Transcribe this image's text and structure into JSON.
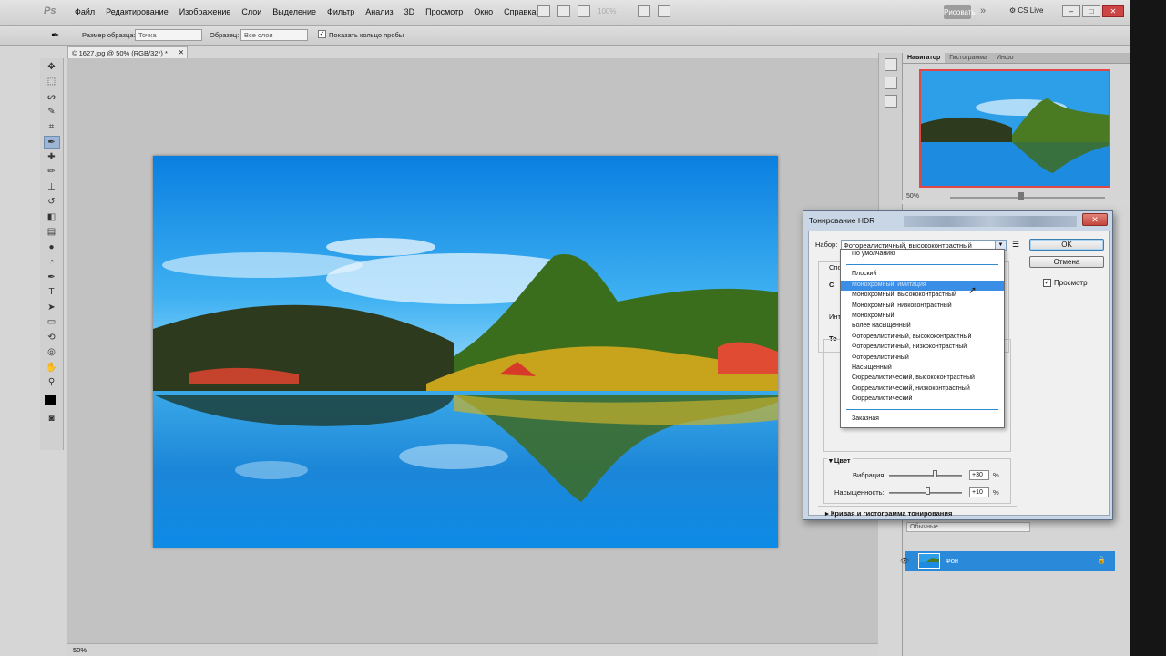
{
  "menubar": {
    "logo": "Ps",
    "items": [
      "Файл",
      "Редактирование",
      "Изображение",
      "Слои",
      "Выделение",
      "Фильтр",
      "Анализ",
      "3D",
      "Просмотр",
      "Окно",
      "Справка"
    ],
    "zoom": "100%",
    "workspace": "Рисовать",
    "cs_live": "CS Live"
  },
  "options": {
    "sample_size_label": "Размер образца:",
    "sample_size_value": "Точка",
    "sample_label": "Образец:",
    "sample_value": "Все слои",
    "show_ring_label": "Показать кольцо пробы"
  },
  "document": {
    "tab_title": "© 1627.jpg @ 50% (RGB/32*) *",
    "zoom": "50%"
  },
  "navigator": {
    "tabs": [
      "Навигатор",
      "Гистограмма",
      "Инфо"
    ],
    "zoom": "50%"
  },
  "layers": {
    "blend_mode": "Обычные",
    "layer_name": "Фон"
  },
  "dialog": {
    "title": "Тонирование HDR",
    "preset_label": "Набор:",
    "preset_value": "Фотореалистичный, высококонтрастный",
    "ok_label": "OK",
    "cancel_label": "Отмена",
    "preview_label": "Просмотр",
    "partial_labels": [
      "Спо",
      "С",
      "Инт",
      "То"
    ],
    "color_section": "Цвет",
    "vibrance_label": "Вибрация:",
    "vibrance_value": "+30",
    "saturation_label": "Насыщенность:",
    "saturation_value": "+10",
    "percent": "%",
    "curve_section": "Кривая и гистограмма тонирования"
  },
  "dropdown": {
    "items_top": [
      "По умолчанию"
    ],
    "items_mid": [
      "Плоский",
      "Монохромный, имитация",
      "Монохромный, высококонтрастный",
      "Монохромный, низкоконтрастный",
      "Монохромный",
      "Более насыщенный",
      "Фотореалистичный, высококонтрастный",
      "Фотореалистичный, низкоконтрастный",
      "Фотореалистичный",
      "Насыщенный",
      "Сюрреалистический, высококонтрастный",
      "Сюрреалистический, низкоконтрастный",
      "Сюрреалистический"
    ],
    "items_bottom": [
      "Заказная"
    ],
    "highlighted": "Монохромный, имитация"
  }
}
